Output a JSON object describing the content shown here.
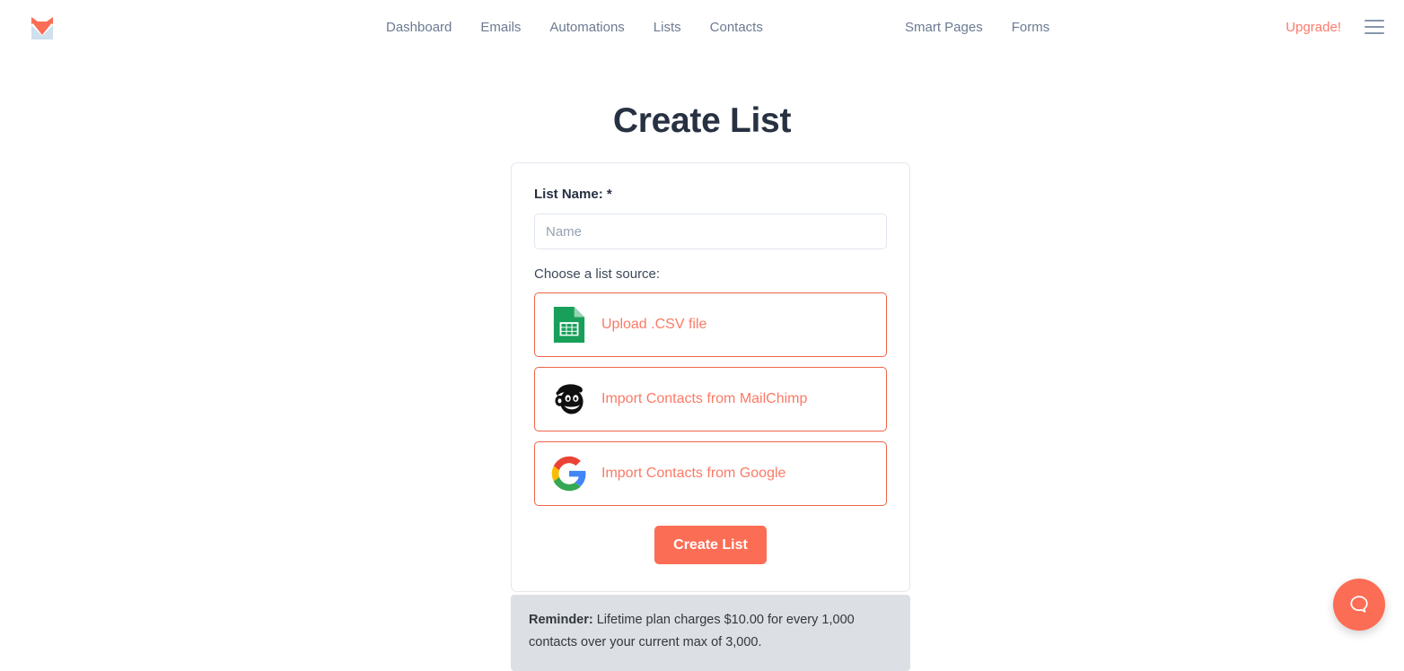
{
  "brand": {
    "logo_icon": "fox-envelope-logo"
  },
  "nav": {
    "primary": [
      {
        "label": "Dashboard",
        "name": "nav-dashboard"
      },
      {
        "label": "Emails",
        "name": "nav-emails"
      },
      {
        "label": "Automations",
        "name": "nav-automations"
      },
      {
        "label": "Lists",
        "name": "nav-lists"
      },
      {
        "label": "Contacts",
        "name": "nav-contacts"
      }
    ],
    "secondary": [
      {
        "label": "Smart Pages",
        "name": "nav-smart-pages"
      },
      {
        "label": "Forms",
        "name": "nav-forms"
      }
    ],
    "upgrade_label": "Upgrade!",
    "menu_icon": "hamburger-menu-icon"
  },
  "page": {
    "title": "Create List"
  },
  "form": {
    "list_name_label": "List Name: *",
    "list_name_value": "",
    "list_name_placeholder": "Name",
    "source_label": "Choose a list source:",
    "sources": [
      {
        "label": "Upload .CSV file",
        "icon": "csv-spreadsheet-icon"
      },
      {
        "label": "Import Contacts from MailChimp",
        "icon": "mailchimp-icon"
      },
      {
        "label": "Import Contacts from Google",
        "icon": "google-icon"
      }
    ],
    "submit_label": "Create List"
  },
  "reminder": {
    "prefix": "Reminder:",
    "text": " Lifetime plan charges $10.00 for every 1,000 contacts over your current max of 3,000."
  },
  "help": {
    "icon": "chat-bubble-icon"
  },
  "colors": {
    "accent": "#fc6d55",
    "accent_border": "#f06449",
    "nav_text": "#6c7a91",
    "title": "#273142",
    "reminder_bg": "#dcdfe3"
  }
}
